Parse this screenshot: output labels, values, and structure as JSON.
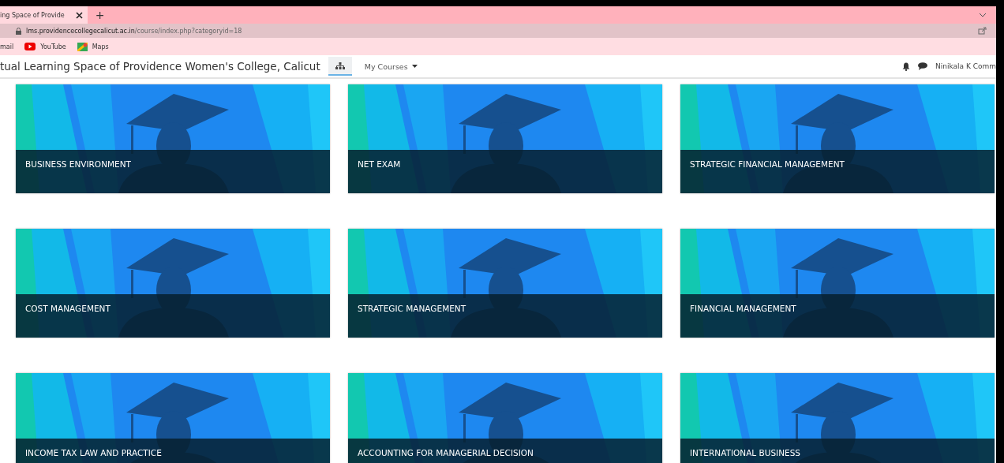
{
  "browser": {
    "tab_title": "ing Space of Provide",
    "new_tab": "+",
    "url_host": "lms.providencecollegecalicut.ac.in",
    "url_path": "/course/index.php?categoryid=18",
    "bookmarks": [
      {
        "label": "mail",
        "kind": "plain"
      },
      {
        "label": "YouTube",
        "kind": "youtube"
      },
      {
        "label": "Maps",
        "kind": "maps"
      }
    ]
  },
  "navbar": {
    "site_name": "tual Learning Space of Providence Women's College, Calicut",
    "menu": "My Courses",
    "user": "Ninikala K Comm"
  },
  "courses": [
    {
      "title": "BUSINESS ENVIRONMENT"
    },
    {
      "title": "NET EXAM"
    },
    {
      "title": "STRATEGIC FINANCIAL MANAGEMENT"
    },
    {
      "title": "COST MANAGEMENT"
    },
    {
      "title": "STRATEGIC MANAGEMENT"
    },
    {
      "title": "FINANCIAL MANAGEMENT"
    },
    {
      "title": "INCOME TAX LAW AND PRACTICE"
    },
    {
      "title": "ACCOUNTING FOR MANAGERIAL DECISION"
    },
    {
      "title": "INTERNATIONAL BUSINESS"
    }
  ]
}
